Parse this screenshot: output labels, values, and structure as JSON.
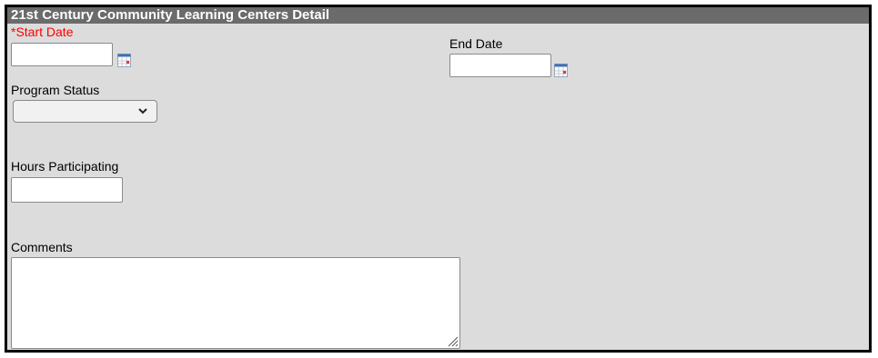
{
  "header": {
    "title": "21st Century Community Learning Centers Detail"
  },
  "fields": {
    "start_date": {
      "label": "*Start Date",
      "value": "",
      "icon": "calendar-icon"
    },
    "end_date": {
      "label": "End Date",
      "value": "",
      "icon": "calendar-icon"
    },
    "program_status": {
      "label": "Program Status",
      "selected": "",
      "icon": "chevron-down-icon"
    },
    "hours_participating": {
      "label": "Hours Participating",
      "value": ""
    },
    "comments": {
      "label": "Comments",
      "value": ""
    }
  },
  "colors": {
    "panel_bg": "#dcdcdc",
    "header_bg": "#6b6b6b",
    "required_label": "#ff0000",
    "border": "#000000"
  }
}
